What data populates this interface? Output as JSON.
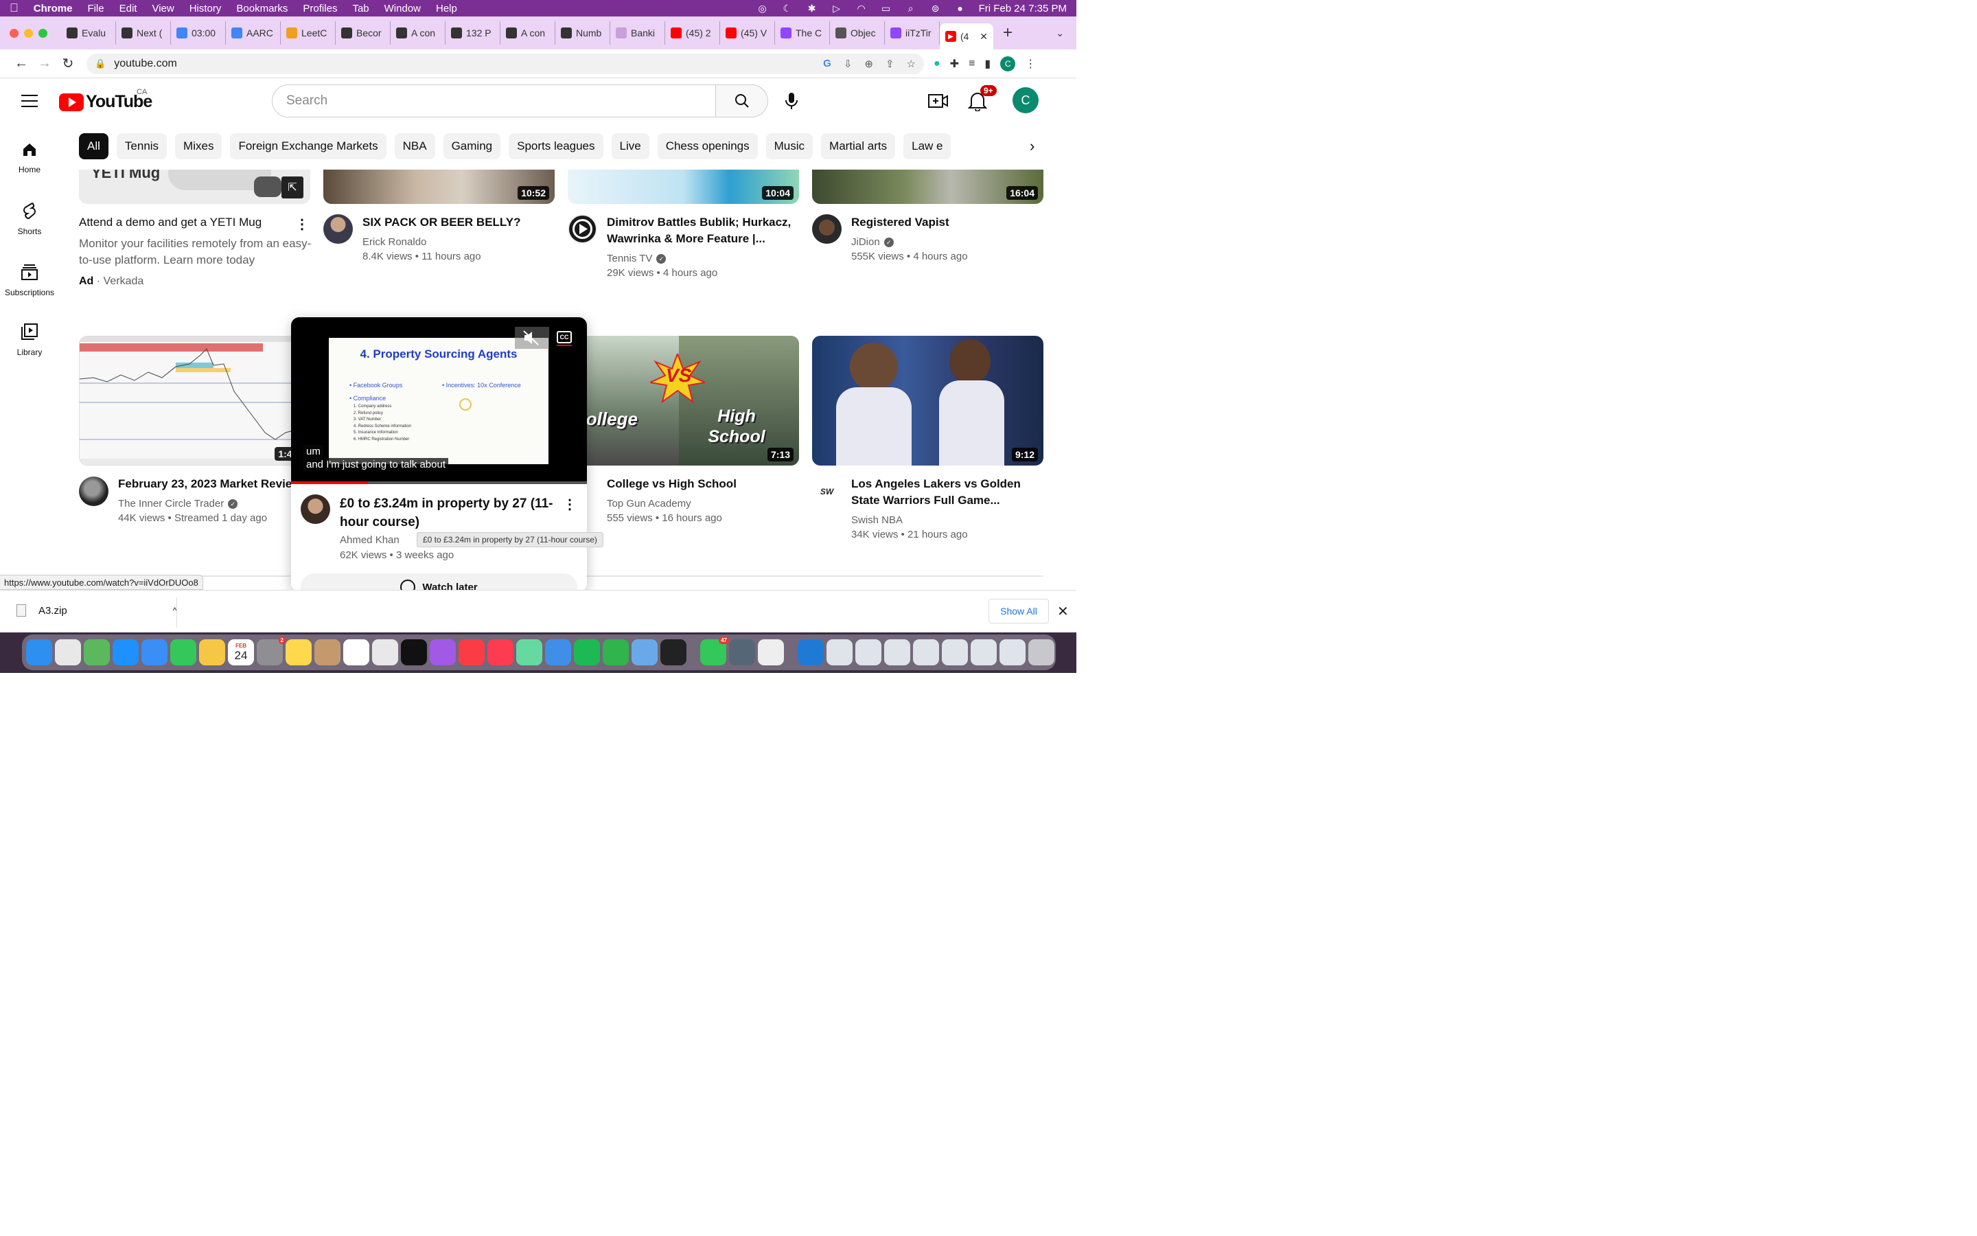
{
  "menubar": {
    "items": [
      "Chrome",
      "File",
      "Edit",
      "View",
      "History",
      "Bookmarks",
      "Profiles",
      "Tab",
      "Window",
      "Help"
    ],
    "datetime": "Fri Feb 24  7:35 PM"
  },
  "tabs": [
    {
      "label": "Evalu",
      "icon": "openai-icon",
      "color": "#333333"
    },
    {
      "label": "Next (",
      "icon": "openai-icon",
      "color": "#333333"
    },
    {
      "label": "03:00",
      "icon": "google-icon",
      "color": "#4285f4"
    },
    {
      "label": "AARC",
      "icon": "docs-icon",
      "color": "#4285f4"
    },
    {
      "label": "LeetC",
      "icon": "leetcode-icon",
      "color": "#f0a020"
    },
    {
      "label": "Becor",
      "icon": "openai-icon",
      "color": "#333333"
    },
    {
      "label": "A con",
      "icon": "openai-icon",
      "color": "#333333"
    },
    {
      "label": "132 P",
      "icon": "openai-icon",
      "color": "#333333"
    },
    {
      "label": "A con",
      "icon": "openai-icon",
      "color": "#333333"
    },
    {
      "label": "Numb",
      "icon": "openai-icon",
      "color": "#333333"
    },
    {
      "label": "Banki",
      "icon": "openai-icon",
      "color": "#c9a0d8"
    },
    {
      "label": "(45) 2",
      "icon": "youtube-icon",
      "color": "#ff0000"
    },
    {
      "label": "(45) V",
      "icon": "youtube-icon",
      "color": "#ff0000"
    },
    {
      "label": "The C",
      "icon": "twitch-icon",
      "color": "#9146ff"
    },
    {
      "label": "Objec",
      "icon": "globe-icon",
      "color": "#555555"
    },
    {
      "label": "iiTzTir",
      "icon": "twitch-icon",
      "color": "#9146ff"
    }
  ],
  "active_tab": {
    "label": "(4",
    "icon": "youtube-icon"
  },
  "address": {
    "url": "youtube.com"
  },
  "youtube": {
    "logo_text": "YouTube",
    "country": "CA",
    "search_placeholder": "Search",
    "notification_count": "9+",
    "avatar_letter": "C"
  },
  "chips": [
    "All",
    "Tennis",
    "Mixes",
    "Foreign Exchange Markets",
    "NBA",
    "Gaming",
    "Sports leagues",
    "Live",
    "Chess openings",
    "Music",
    "Martial arts",
    "Law e"
  ],
  "sidebar": [
    {
      "label": "Home"
    },
    {
      "label": "Shorts"
    },
    {
      "label": "Subscriptions"
    },
    {
      "label": "Library"
    }
  ],
  "row1": {
    "ad": {
      "thumb_text": "YETI Mug",
      "title": "Attend a demo and get a YETI Mug",
      "desc": "Monitor your facilities remotely from an easy-to-use platform. Learn more today",
      "ad_label": "Ad",
      "advertiser": "Verkada"
    },
    "videos": [
      {
        "title": "SIX PACK OR BEER BELLY?",
        "channel": "Erick Ronaldo",
        "views": "8.4K views",
        "age": "11 hours ago",
        "duration": "10:52",
        "verified": false
      },
      {
        "title": "Dimitrov Battles Bublik; Hurkacz, Wawrinka & More Feature |...",
        "channel": "Tennis TV",
        "views": "29K views",
        "age": "4 hours ago",
        "duration": "10:04",
        "verified": true
      },
      {
        "title": "Registered Vapist",
        "channel": "JiDion",
        "views": "555K views",
        "age": "4 hours ago",
        "duration": "16:04",
        "verified": true
      }
    ]
  },
  "row2": [
    {
      "title": "February 23, 2023 Market Review",
      "channel": "The Inner Circle Trader",
      "views": "44K views",
      "age": "Streamed 1 day ago",
      "duration": "1:40:",
      "verified": true
    },
    {
      "title": "College vs High School",
      "channel": "Top Gun Academy",
      "views": "555 views",
      "age": "16 hours ago",
      "duration": "7:13",
      "verified": false,
      "thumb_left": "College",
      "thumb_right": "High School",
      "thumb_vs": "VS"
    },
    {
      "title": "Los Angeles Lakers vs Golden State Warriors Full Game...",
      "channel": "Swish NBA",
      "views": "34K views",
      "age": "21 hours ago",
      "duration": "9:12",
      "verified": false
    }
  ],
  "miniplayer": {
    "slide_title": "4. Property Sourcing Agents",
    "bullet_left_1": "Facebook Groups",
    "bullet_left_2": "Compliance",
    "sub_items": [
      "1. Company address",
      "2. Refund policy",
      "3. VAT Number",
      "4. Redress Scheme information",
      "5. Insurance Information",
      "6. HMRC Registration Number"
    ],
    "bullet_right": "Incentives: 10x Conference",
    "caption_1": "um",
    "caption_2": "and I'm just going to talk about",
    "cc_label": "CC",
    "title": "£0 to £3.24m in property by 27 (11-hour course)",
    "channel": "Ahmed Khan",
    "views": "62K views",
    "age": "3 weeks ago",
    "watch_later": "Watch later",
    "tooltip": "£0 to £3.24m in property by 27 (11-hour course)",
    "progress": 0.26
  },
  "status_url": "https://www.youtube.com/watch?v=iiVdOrDUOo8",
  "downloads": {
    "file": "A3.zip",
    "show_all": "Show All"
  },
  "dock": {
    "calendar_month": "FEB",
    "calendar_day": "24",
    "settings_badge": "2",
    "messages_badge": "47",
    "apps": [
      {
        "name": "finder-icon",
        "color": "#2d8ff0"
      },
      {
        "name": "launchpad-icon",
        "color": "#e8e8e8"
      },
      {
        "name": "maps-icon",
        "color": "#5cb85c"
      },
      {
        "name": "safari-icon",
        "color": "#1e90ff"
      },
      {
        "name": "mail-icon",
        "color": "#3a8ef6"
      },
      {
        "name": "facetime-icon",
        "color": "#34c759"
      },
      {
        "name": "photos-icon",
        "color": "#f6c744"
      },
      {
        "name": "calendar-icon",
        "color": "#ffffff"
      },
      {
        "name": "settings-icon",
        "color": "#8e8e93"
      },
      {
        "name": "notes-icon",
        "color": "#ffd84d"
      },
      {
        "name": "contacts-icon",
        "color": "#c49a6c"
      },
      {
        "name": "reminders-icon",
        "color": "#ffffff"
      },
      {
        "name": "chrome-icon",
        "color": "#e8e8e8"
      },
      {
        "name": "appletv-icon",
        "color": "#111111"
      },
      {
        "name": "podcasts-icon",
        "color": "#a259e6"
      },
      {
        "name": "music-icon",
        "color": "#fc3c44"
      },
      {
        "name": "news-icon",
        "color": "#ff3b52"
      },
      {
        "name": "atom-icon",
        "color": "#66d9a0"
      },
      {
        "name": "keynote-icon",
        "color": "#3f8fe8"
      },
      {
        "name": "spotify-icon",
        "color": "#1db954"
      },
      {
        "name": "numbers-icon",
        "color": "#2fb54c"
      },
      {
        "name": "preview-icon",
        "color": "#6aa9e9"
      },
      {
        "name": "terminal-icon",
        "color": "#222222"
      },
      {
        "name": "messages-icon",
        "color": "#34c759"
      },
      {
        "name": "screen-icon",
        "color": "#556677"
      },
      {
        "name": "textedit-icon",
        "color": "#eeeeee"
      },
      {
        "name": "vscode-icon",
        "color": "#1f7ad6"
      }
    ]
  }
}
